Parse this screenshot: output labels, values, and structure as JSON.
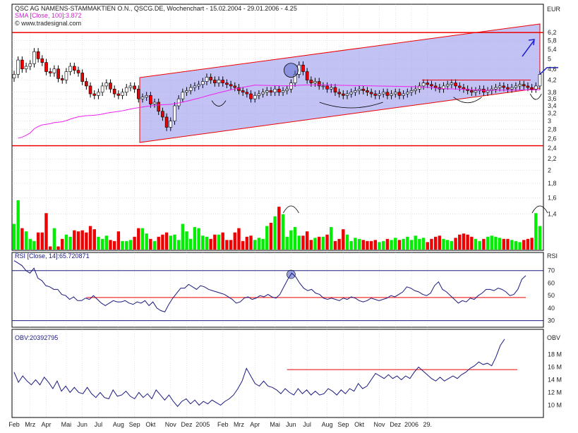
{
  "header": {
    "title_line": "QSC AG NAMENS-STAMMAKTIEN O.N., QSCG.DE, Wochenchart - 15.02.2004 - 29.01.2006 - 4.25",
    "sma_line": "SMA [Close, 100]:3.872",
    "source_line": "© www.tradesignal.com"
  },
  "colors": {
    "up": "#00ee00",
    "down": "#ee0000",
    "channel_fill": "#9999ee",
    "sma": "#ee22ee",
    "red_line": "#ee0000",
    "indicator_line": "#1a1a80",
    "blue_line": "#2020cc",
    "grid": "#c8c8c8"
  },
  "icons": [
    "up-arrow-icon"
  ],
  "chart_data": [
    {
      "type": "candlestick",
      "name": "price",
      "unit_label": "EUR",
      "scale": "log",
      "ylim": [
        1.2,
        6.5
      ],
      "ticks": [
        "6,2",
        "5,8",
        "5,4",
        "5",
        "4,6",
        "4,2",
        "3,8",
        "3,6",
        "3,4",
        "3,2",
        "3",
        "2,8",
        "2,6",
        "2,4",
        "2,2",
        "2",
        "1,8",
        "1,6",
        "1,4"
      ],
      "tick_values": [
        6.2,
        5.8,
        5.4,
        5.0,
        4.6,
        4.2,
        3.8,
        3.6,
        3.4,
        3.2,
        3.0,
        2.8,
        2.6,
        2.4,
        2.2,
        2.0,
        1.8,
        1.6,
        1.4
      ],
      "close": [
        4.4,
        4.95,
        4.6,
        4.7,
        4.8,
        5.3,
        5.0,
        4.85,
        4.5,
        4.45,
        4.6,
        4.25,
        4.2,
        4.5,
        4.7,
        4.55,
        4.45,
        4.15,
        4.0,
        3.75,
        3.7,
        3.8,
        4.0,
        4.1,
        3.9,
        3.75,
        3.7,
        3.8,
        3.95,
        4.0,
        3.9,
        3.6,
        3.65,
        3.7,
        3.45,
        3.5,
        3.25,
        3.1,
        2.85,
        3.0,
        3.4,
        3.6,
        3.8,
        3.85,
        3.95,
        4.0,
        4.05,
        4.15,
        4.3,
        4.2,
        4.1,
        4.2,
        4.1,
        4.05,
        4.0,
        3.95,
        3.85,
        3.8,
        3.75,
        3.6,
        3.7,
        3.75,
        3.8,
        3.85,
        3.8,
        3.9,
        3.8,
        3.85,
        3.9,
        4.1,
        4.4,
        4.75,
        4.5,
        4.2,
        4.1,
        4.15,
        4.0,
        4.0,
        3.9,
        3.95,
        3.8,
        3.75,
        3.7,
        3.75,
        3.8,
        3.85,
        3.9,
        3.85,
        3.8,
        3.75,
        3.7,
        3.75,
        3.8,
        3.7,
        3.75,
        3.8,
        3.7,
        3.75,
        3.8,
        3.85,
        3.9,
        4.0,
        4.1,
        4.05,
        4.0,
        3.95,
        3.9,
        4.0,
        4.05,
        4.1,
        4.0,
        3.95,
        3.9,
        3.85,
        3.8,
        3.85,
        3.9,
        3.8,
        3.85,
        3.9,
        3.95,
        4.0,
        3.95,
        3.9,
        3.95,
        4.0,
        4.05,
        4.0,
        3.95,
        3.9,
        4.0,
        4.4
      ],
      "sma_last": 3.872,
      "horizontal_lines": [
        6.2,
        2.45
      ],
      "target_line": 4.65
    },
    {
      "type": "bar",
      "name": "volume",
      "values": [
        24,
        46,
        20,
        17,
        10,
        8,
        16,
        16,
        34,
        3,
        20,
        3,
        10,
        14,
        12,
        18,
        17,
        18,
        16,
        22,
        19,
        12,
        10,
        13,
        9,
        8,
        17,
        8,
        8,
        9,
        12,
        20,
        20,
        15,
        10,
        8,
        12,
        14,
        16,
        13,
        14,
        9,
        24,
        17,
        10,
        21,
        20,
        13,
        12,
        10,
        14,
        14,
        16,
        9,
        9,
        16,
        20,
        8,
        12,
        13,
        9,
        11,
        10,
        22,
        25,
        31,
        40,
        33,
        12,
        18,
        21,
        13,
        13,
        17,
        9,
        11,
        12,
        12,
        14,
        21,
        8,
        10,
        19,
        14,
        8,
        11,
        10,
        9,
        8,
        8,
        9,
        7,
        8,
        10,
        9,
        11,
        9,
        10,
        12,
        9,
        13,
        10,
        11,
        7,
        10,
        12,
        13,
        10,
        9,
        8,
        11,
        14,
        15,
        14,
        12,
        10,
        8,
        10,
        12,
        13,
        12,
        11,
        10,
        10,
        9,
        8,
        7,
        9,
        10,
        11,
        34,
        22,
        24
      ]
    },
    {
      "type": "line",
      "name": "RSI",
      "label": "RSI [Close, 14]:65.720871",
      "unit_label": "RSI",
      "ylim": [
        27,
        80
      ],
      "ticks": [
        "70",
        "60",
        "50",
        "40",
        "30"
      ],
      "tick_values": [
        70,
        60,
        50,
        40,
        30
      ],
      "horizontal_lines": [
        70,
        48.5,
        30
      ],
      "values": [
        78,
        76,
        74,
        70,
        68,
        72,
        64,
        62,
        58,
        57,
        55,
        55,
        51,
        50,
        47,
        49,
        46,
        46,
        48,
        47,
        50,
        47,
        44,
        42,
        44,
        46,
        45,
        45,
        46,
        44,
        43,
        45,
        44,
        46,
        42,
        45,
        40,
        38,
        37,
        43,
        48,
        52,
        56,
        56,
        59,
        57,
        55,
        58,
        57,
        55,
        54,
        53,
        52,
        51,
        49,
        47,
        44,
        45,
        48,
        49,
        47,
        48,
        50,
        49,
        51,
        49,
        48,
        51,
        57,
        63,
        68,
        65,
        60,
        56,
        54,
        55,
        52,
        51,
        48,
        47,
        48,
        47,
        46,
        48,
        47,
        49,
        48,
        46,
        45,
        46,
        48,
        47,
        46,
        47,
        48,
        50,
        49,
        51,
        53,
        57,
        56,
        54,
        53,
        51,
        50,
        52,
        58,
        61,
        55,
        53,
        50,
        47,
        44,
        46,
        45,
        48,
        47,
        50,
        52,
        55,
        55,
        54,
        56,
        55,
        53,
        50,
        51,
        55,
        63,
        66
      ]
    },
    {
      "type": "line",
      "name": "OBV",
      "label": "OBV:20392795",
      "unit_label": "OBV",
      "ylim": [
        8.5,
        20.5
      ],
      "ticks": [
        "18 M",
        "16 M",
        "14 M",
        "12 M",
        "10 M"
      ],
      "tick_values": [
        18,
        16,
        14,
        12,
        10
      ],
      "horizontal_lines": [
        15.6
      ],
      "values": [
        15.2,
        13.6,
        14.6,
        13.8,
        13.2,
        14.0,
        13.2,
        14.4,
        13.6,
        12.6,
        13.8,
        12.2,
        13.0,
        12.0,
        12.8,
        12.0,
        11.8,
        12.8,
        11.8,
        11.2,
        12.0,
        11.2,
        11.0,
        12.4,
        11.4,
        11.6,
        12.2,
        11.4,
        11.0,
        12.0,
        11.2,
        11.8,
        11.0,
        12.4,
        11.6,
        10.8,
        11.6,
        10.6,
        9.8,
        10.6,
        11.0,
        10.2,
        10.8,
        10.0,
        10.6,
        10.2,
        10.8,
        10.4,
        10.0,
        10.6,
        11.0,
        11.6,
        12.6,
        13.8,
        15.8,
        14.6,
        13.4,
        13.0,
        13.8,
        13.0,
        12.8,
        12.4,
        11.8,
        12.6,
        12.0,
        11.6,
        12.6,
        11.8,
        12.4,
        11.6,
        12.2,
        11.6,
        11.8,
        12.6,
        12.2,
        11.6,
        12.4,
        11.8,
        12.6,
        12.2,
        13.4,
        12.6,
        13.0,
        14.0,
        15.0,
        14.6,
        14.2,
        14.8,
        14.2,
        14.6,
        14.0,
        14.6,
        14.2,
        15.2,
        16.0,
        15.4,
        14.8,
        14.2,
        13.8,
        14.4,
        13.8,
        14.2,
        14.6,
        14.2,
        14.8,
        15.2,
        15.8,
        16.2,
        16.8,
        16.4,
        16.6,
        16.2,
        17.6,
        19.4,
        20.4
      ]
    }
  ],
  "x_axis": {
    "labels": [
      "Feb",
      "Mrz",
      "Apr",
      "Mai",
      "Jun",
      "Jul",
      "Aug",
      "Sep",
      "Okt",
      "Nov",
      "Dez",
      "2005",
      "Feb",
      "Mrz",
      "Apr",
      "Mai",
      "Jun",
      "Jul",
      "Aug",
      "Sep",
      "Okt",
      "Nov",
      "Dez",
      "2006",
      "29."
    ],
    "label_weeks": [
      0,
      4,
      8,
      13,
      17,
      21,
      26,
      30,
      34,
      39,
      43,
      47,
      52,
      56,
      60,
      65,
      69,
      73,
      78,
      82,
      86,
      91,
      95,
      99,
      103
    ]
  }
}
